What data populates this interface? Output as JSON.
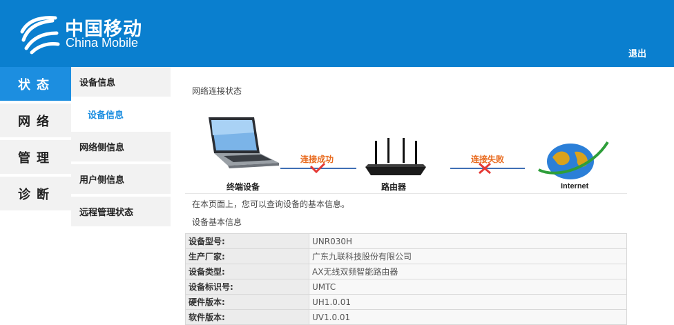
{
  "header": {
    "brand_cn": "中国移动",
    "brand_en": "China Mobile",
    "logout_label": "退出",
    "bg_color": "#0a7fcf"
  },
  "nav_primary": [
    {
      "label": "状态",
      "active": true
    },
    {
      "label": "网络",
      "active": false
    },
    {
      "label": "管理",
      "active": false
    },
    {
      "label": "诊断",
      "active": false
    }
  ],
  "nav_secondary": [
    {
      "label": "设备信息"
    },
    {
      "label": "设备信息",
      "child": true,
      "active": true
    },
    {
      "label": "网络侧信息"
    },
    {
      "label": "用户侧信息"
    },
    {
      "label": "远程管理状态"
    }
  ],
  "content": {
    "connection_title": "网络连接状态",
    "diagram": {
      "terminal_label": "终端设备",
      "router_label": "路由器",
      "internet_label": "Internet",
      "link1_status": "连接成功",
      "link2_status": "连接失败"
    },
    "intro": "在本页面上，您可以查询设备的基本信息。",
    "info_title": "设备基本信息",
    "rows": [
      {
        "key": "设备型号:",
        "value": "UNR030H"
      },
      {
        "key": "生产厂家:",
        "value": "广东九联科技股份有限公司"
      },
      {
        "key": "设备类型:",
        "value": "AX无线双频智能路由器"
      },
      {
        "key": "设备标识号:",
        "value": "UMTC"
      },
      {
        "key": "硬件版本:",
        "value": "UH1.0.01"
      },
      {
        "key": "软件版本:",
        "value": "UV1.0.01"
      }
    ]
  }
}
